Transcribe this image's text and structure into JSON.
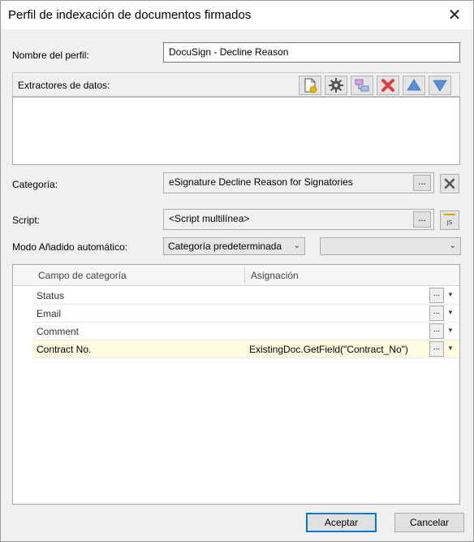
{
  "window": {
    "title": "Perfil de indexación de documentos firmados",
    "close_glyph": "✕"
  },
  "profile_name": {
    "label": "Nombre del perfil:",
    "value": "DocuSign - Decline Reason"
  },
  "extractors": {
    "label": "Extractores de datos:",
    "toolbar": [
      {
        "name": "new-extractor-icon"
      },
      {
        "name": "gear-icon"
      },
      {
        "name": "map-fields-icon"
      },
      {
        "name": "delete-icon"
      },
      {
        "name": "move-up-icon"
      },
      {
        "name": "move-down-icon"
      }
    ],
    "items": []
  },
  "category": {
    "label": "Categoría:",
    "value": "eSignature Decline Reason for Signatories",
    "browse": "...",
    "clear_glyph": "✕"
  },
  "script": {
    "label": "Script:",
    "value": "<Script multilínea>",
    "browse": "...",
    "js_glyph": "JS"
  },
  "auto_add": {
    "label": "Modo Añadido automático:",
    "mode": "Categoría predeterminada",
    "secondary": ""
  },
  "grid": {
    "columns": [
      "Campo de categoría",
      "Asignación"
    ],
    "rows": [
      {
        "field": "Status",
        "mapping": "",
        "btn": "...",
        "arrow": "▼"
      },
      {
        "field": "Email",
        "mapping": "",
        "btn": "...",
        "arrow": "▼"
      },
      {
        "field": "Comment",
        "mapping": "",
        "btn": "...",
        "arrow": "▼"
      },
      {
        "field": "Contract No.",
        "mapping": "ExistingDoc.GetField(\"Contract_No\")",
        "btn": "...",
        "arrow": "▼"
      }
    ]
  },
  "buttons": {
    "accept": "Aceptar",
    "cancel": "Cancelar"
  },
  "colors": {
    "accent": "#0078d7",
    "delete_red": "#e33e3e",
    "arrow_blue": "#5b8fd6",
    "selected_row": "#fffbe0"
  }
}
